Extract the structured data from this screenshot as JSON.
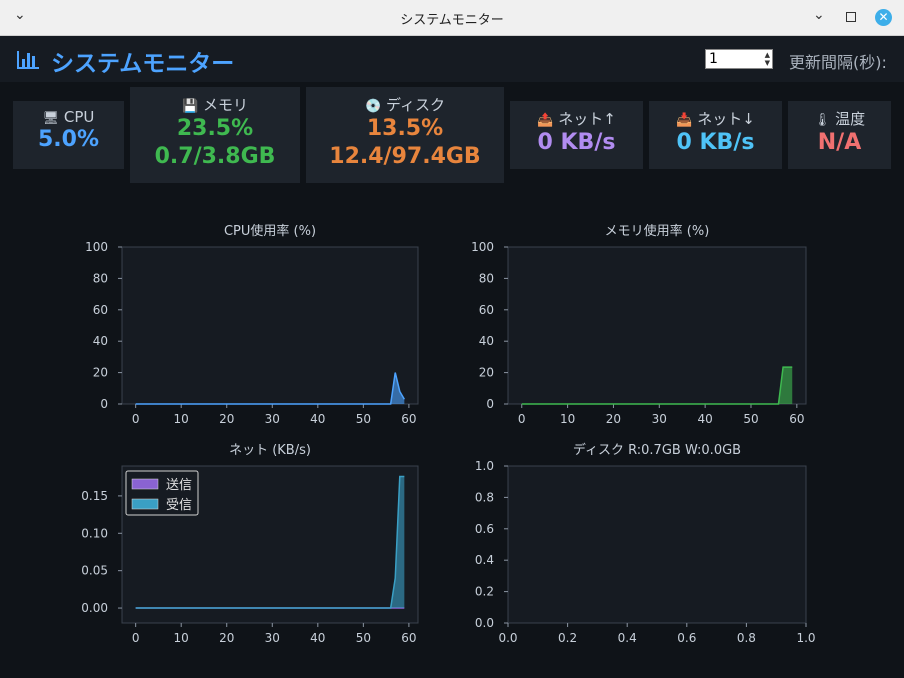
{
  "window": {
    "title": "システムモニター"
  },
  "header": {
    "title": "システムモニター",
    "interval_value": "1",
    "interval_label": "更新間隔(秒):"
  },
  "cards": {
    "cpu": {
      "icon": "🖥",
      "label": "CPU",
      "value": "5.0%"
    },
    "memory": {
      "icon": "💾",
      "label": "メモリ",
      "value": "23.5%",
      "value2": "0.7/3.8GB"
    },
    "disk": {
      "icon": "💿",
      "label": "ディスク",
      "value": "13.5%",
      "value2": "12.4/97.4GB"
    },
    "net_up": {
      "icon": "📤",
      "label": "ネット↑",
      "value": "0 KB/s"
    },
    "net_down": {
      "icon": "📥",
      "label": "ネット↓",
      "value": "0 KB/s"
    },
    "temp": {
      "icon": "🌡",
      "label": "温度",
      "value": "N/A"
    }
  },
  "colors": {
    "cpu": "#4da3ff",
    "memory": "#3fb950",
    "disk": "#e8853d",
    "net_up": "#b18cf0",
    "net_down": "#4fc3f7",
    "temp": "#f07070"
  },
  "chart_data": [
    {
      "type": "area",
      "title": "CPU使用率 (%)",
      "xlim": [
        0,
        60
      ],
      "ylim": [
        0,
        100
      ],
      "xticks": [
        "0",
        "10",
        "20",
        "30",
        "40",
        "50",
        "60"
      ],
      "yticks": [
        "0",
        "20",
        "40",
        "60",
        "80",
        "100"
      ],
      "series": [
        {
          "color": "#4da3ff",
          "x": [
            0,
            56,
            57,
            58,
            59
          ],
          "y": [
            0,
            0,
            20,
            8,
            3
          ]
        }
      ]
    },
    {
      "type": "area",
      "title": "メモリ使用率 (%)",
      "xlim": [
        0,
        60
      ],
      "ylim": [
        0,
        100
      ],
      "xticks": [
        "0",
        "10",
        "20",
        "30",
        "40",
        "50",
        "60"
      ],
      "yticks": [
        "0",
        "20",
        "40",
        "60",
        "80",
        "100"
      ],
      "series": [
        {
          "color": "#3fb950",
          "x": [
            0,
            56,
            57,
            58,
            59
          ],
          "y": [
            0,
            0,
            23.5,
            23.5,
            23.5
          ]
        }
      ]
    },
    {
      "type": "area",
      "title": "ネット (KB/s)",
      "xlim": [
        0,
        60
      ],
      "ylim": [
        -0.02,
        0.19
      ],
      "xticks": [
        "0",
        "10",
        "20",
        "30",
        "40",
        "50",
        "60"
      ],
      "yticks": [
        "0.00",
        "0.05",
        "0.10",
        "0.15"
      ],
      "legend": "top-left",
      "series": [
        {
          "name": "送信",
          "color": "#8a63d2",
          "x": [
            0,
            56,
            57,
            58,
            59
          ],
          "y": [
            0,
            0,
            0,
            0,
            0
          ]
        },
        {
          "name": "受信",
          "color": "#3a9fc4",
          "x": [
            0,
            56,
            57,
            58,
            59
          ],
          "y": [
            0,
            0,
            0.04,
            0.176,
            0.176
          ]
        }
      ]
    },
    {
      "type": "area",
      "title": "ディスク  R:0.7GB W:0.0GB",
      "xlim": [
        0,
        1
      ],
      "ylim": [
        0,
        1
      ],
      "xticks": [
        "0.0",
        "0.2",
        "0.4",
        "0.6",
        "0.8",
        "1.0"
      ],
      "yticks": [
        "0.0",
        "0.2",
        "0.4",
        "0.6",
        "0.8",
        "1.0"
      ],
      "series": []
    }
  ]
}
